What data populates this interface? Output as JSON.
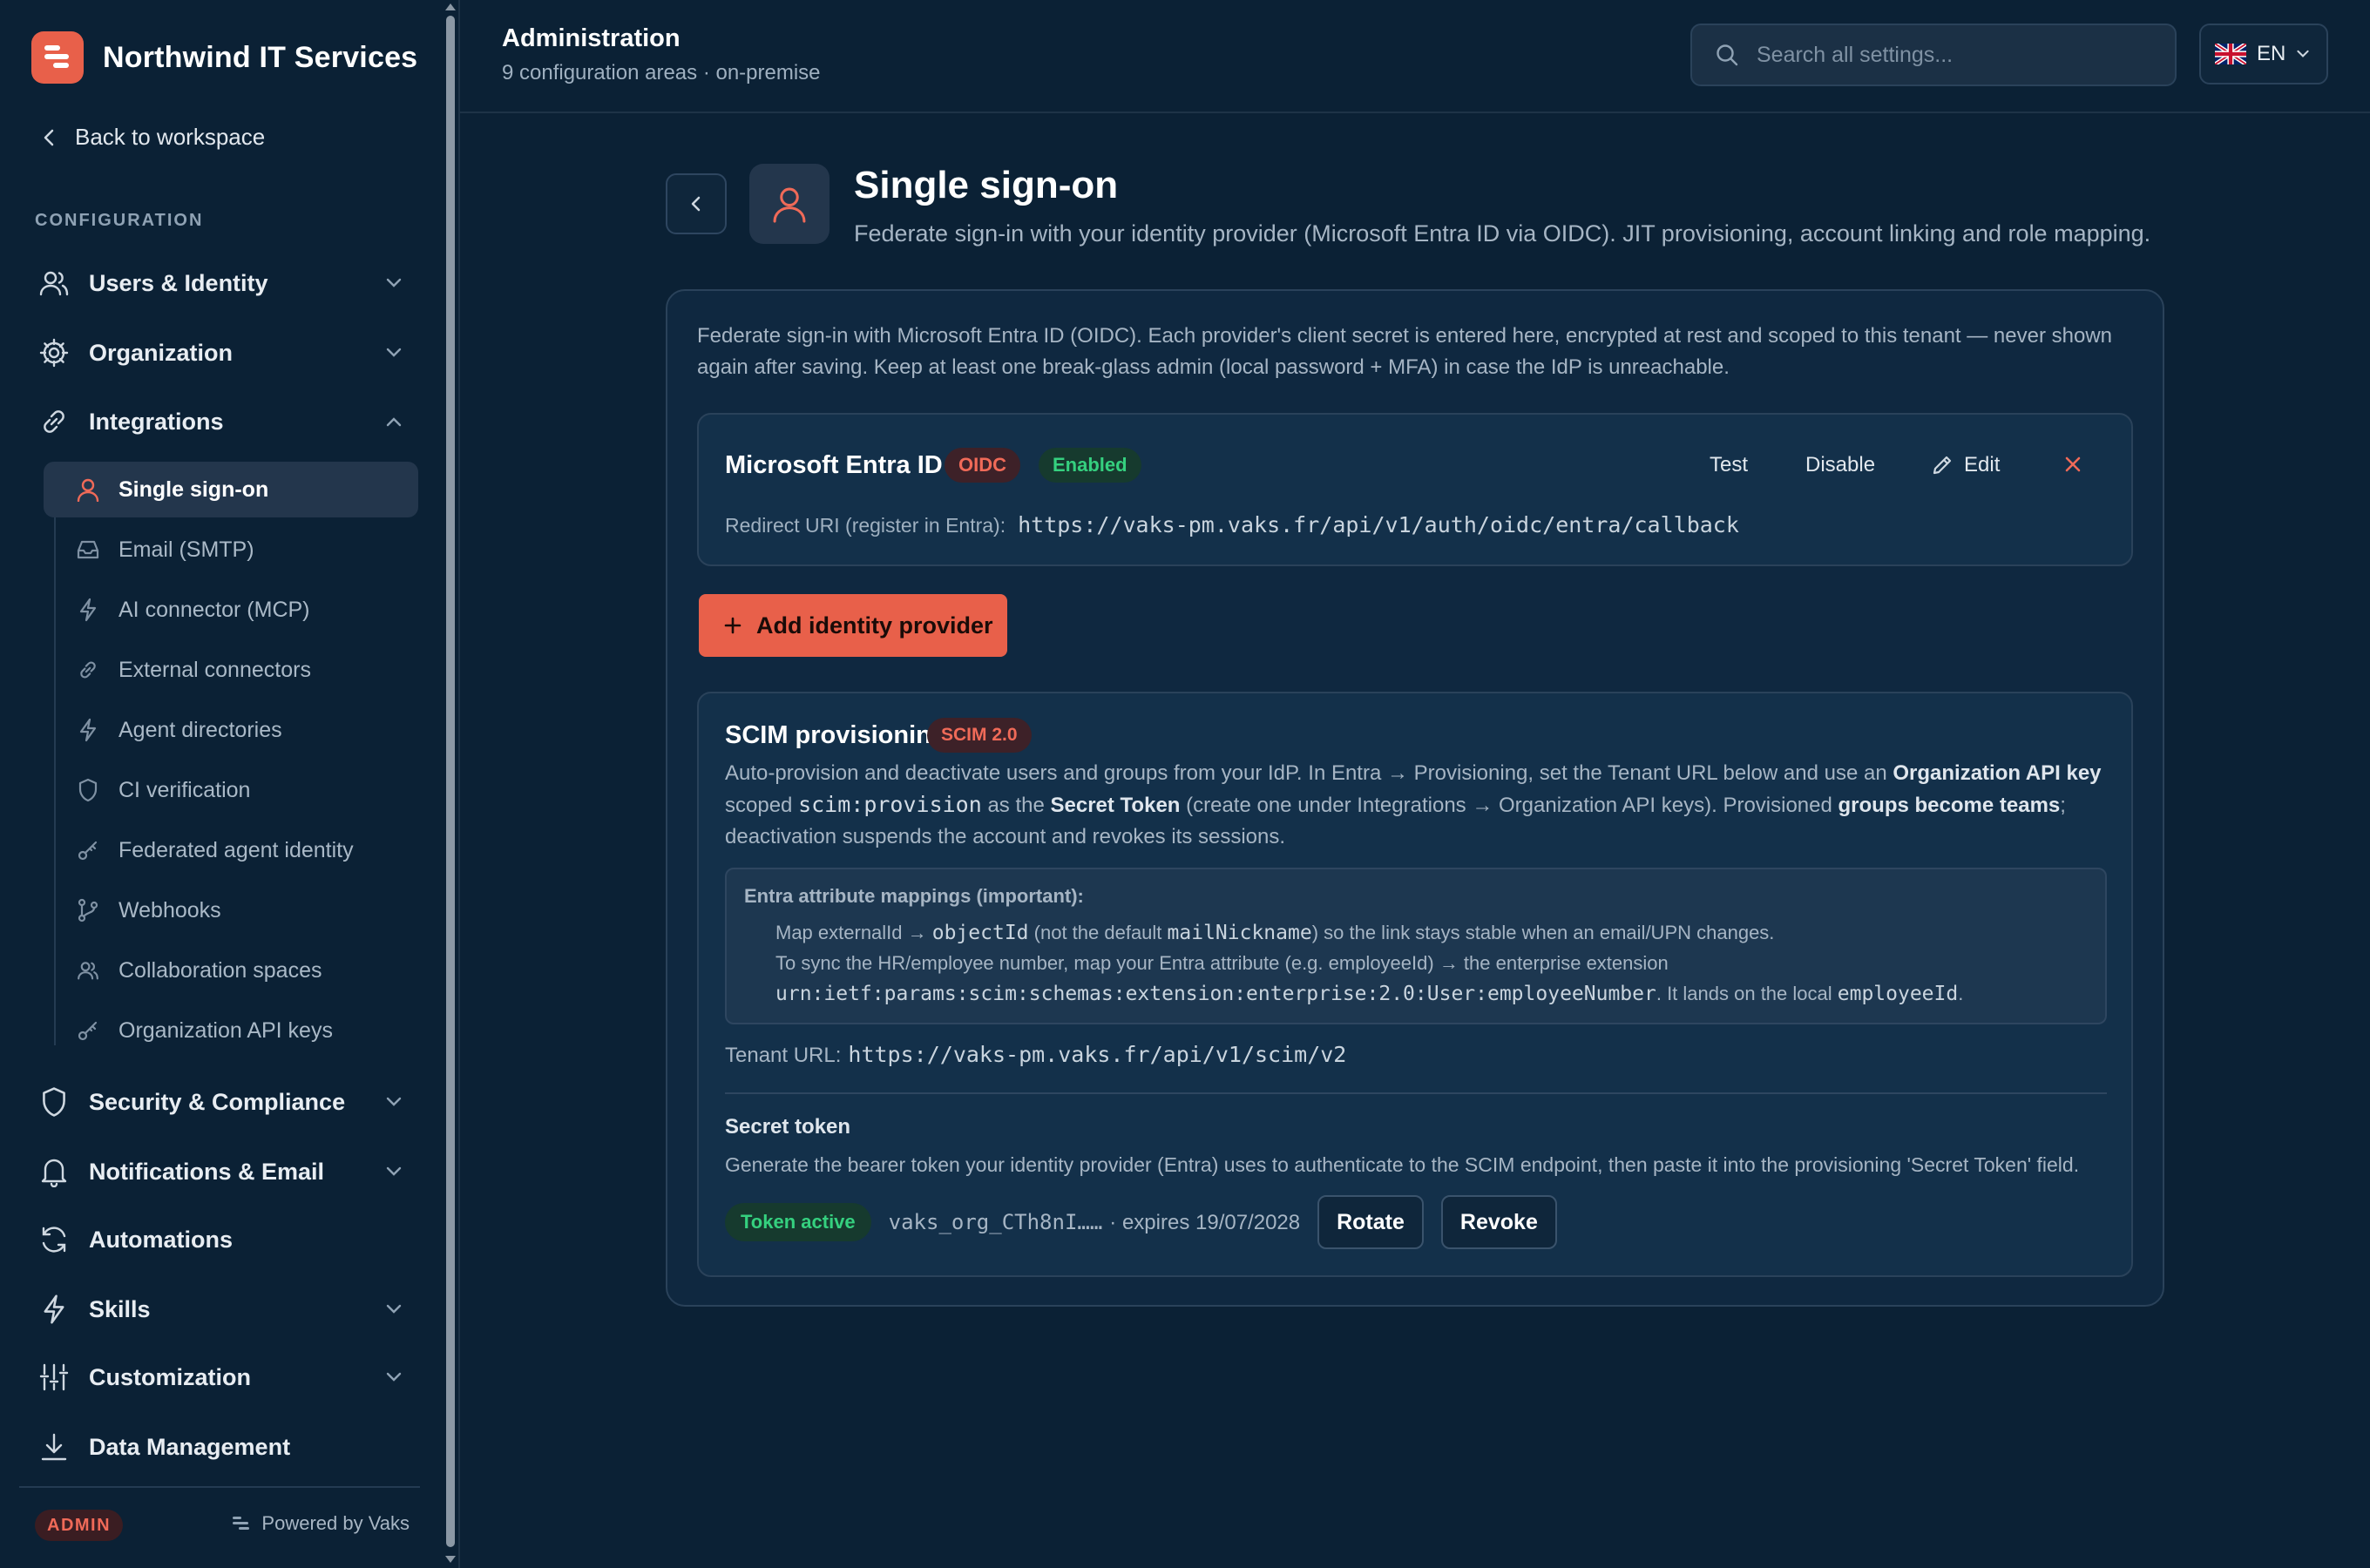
{
  "brand": {
    "name": "Northwind IT Services"
  },
  "sidebar": {
    "back_label": "Back to workspace",
    "section_label": "CONFIGURATION",
    "groups": [
      {
        "label": "Users & Identity",
        "icon": "users-icon",
        "state": "collapsed"
      },
      {
        "label": "Organization",
        "icon": "gear-icon",
        "state": "collapsed"
      },
      {
        "label": "Integrations",
        "icon": "link-icon",
        "state": "expanded"
      },
      {
        "label": "Security & Compliance",
        "icon": "shield-icon",
        "state": "collapsed"
      },
      {
        "label": "Notifications & Email",
        "icon": "bell-icon",
        "state": "collapsed"
      },
      {
        "label": "Automations",
        "icon": "refresh-icon",
        "state": "none"
      },
      {
        "label": "Skills",
        "icon": "bolt-icon",
        "state": "collapsed"
      },
      {
        "label": "Customization",
        "icon": "sliders-icon",
        "state": "collapsed"
      },
      {
        "label": "Data Management",
        "icon": "download-icon",
        "state": "none"
      }
    ],
    "integrations_items": [
      {
        "label": "Single sign-on",
        "icon": "user-icon",
        "active": true
      },
      {
        "label": "Email (SMTP)",
        "icon": "inbox-icon"
      },
      {
        "label": "AI connector (MCP)",
        "icon": "bolt-icon"
      },
      {
        "label": "External connectors",
        "icon": "link-icon"
      },
      {
        "label": "Agent directories",
        "icon": "bolt-icon"
      },
      {
        "label": "CI verification",
        "icon": "shield-icon"
      },
      {
        "label": "Federated agent identity",
        "icon": "key-icon"
      },
      {
        "label": "Webhooks",
        "icon": "git-branch-icon"
      },
      {
        "label": "Collaboration spaces",
        "icon": "users-icon"
      },
      {
        "label": "Organization API keys",
        "icon": "key-icon"
      }
    ],
    "role_badge": "ADMIN",
    "powered_by": "Powered by Vaks"
  },
  "header": {
    "title": "Administration",
    "subtitle": "9 configuration areas · on-premise",
    "search_placeholder": "Search all settings...",
    "language": "EN"
  },
  "page": {
    "title": "Single sign-on",
    "subtitle": "Federate sign-in with your identity provider (Microsoft Entra ID via OIDC). JIT provisioning, account linking and role mapping.",
    "intro": "Federate sign-in with Microsoft Entra ID (OIDC). Each provider's client secret is entered here, encrypted at rest and scoped to this tenant — never shown again after saving. Keep at least one break-glass admin (local password + MFA) in case the IdP is unreachable."
  },
  "provider": {
    "name": "Microsoft Entra ID",
    "protocol_badge": "OIDC",
    "status_badge": "Enabled",
    "actions": {
      "test": "Test",
      "disable": "Disable",
      "edit": "Edit"
    },
    "redirect_label": "Redirect URI (register in Entra):",
    "redirect_uri": "https://vaks-pm.vaks.fr/api/v1/auth/oidc/entra/callback"
  },
  "add_provider_label": "Add identity provider",
  "scim": {
    "title": "SCIM provisioning",
    "badge": "SCIM 2.0",
    "desc": {
      "p1": "Auto-provision and deactivate users and groups from your IdP. In Entra → Provisioning, set the Tenant URL below and use an ",
      "b1": "Organization API key",
      "p2": "scoped ",
      "code1": "scim:provision",
      "p3": " as the ",
      "b2": "Secret Token",
      "p4": " (create one under Integrations → Organization API keys). Provisioned ",
      "b3": "groups become teams",
      "p5": ";",
      "p6": "deactivation suspends the account and revokes its sessions."
    },
    "mappings": {
      "title": "Entra attribute mappings (important):",
      "l1a": "Map externalId → ",
      "l1code1": "objectId",
      "l1b": " (not the default ",
      "l1code2": "mailNickname",
      "l1c": ") so the link stays stable when an email/UPN changes.",
      "l2": "To sync the HR/employee number, map your Entra attribute (e.g. employeeId) → the enterprise extension",
      "l3code": "urn:ietf:params:scim:schemas:extension:enterprise:2.0:User:employeeNumber",
      "l3b": ". It lands on the local ",
      "l3code2": "employeeId",
      "l3c": "."
    },
    "tenant_label": "Tenant URL:",
    "tenant_url": "https://vaks-pm.vaks.fr/api/v1/scim/v2",
    "secret_title": "Secret token",
    "secret_desc": "Generate the bearer token your identity provider (Entra) uses to authenticate to the SCIM endpoint, then paste it into the provisioning 'Secret Token' field.",
    "token_badge": "Token active",
    "token_prefix": "vaks_org_CTh8nI……",
    "token_expiry": "· expires 19/07/2028",
    "rotate_label": "Rotate",
    "revoke_label": "Revoke"
  },
  "colors": {
    "accent": "#e8604a",
    "success": "#35d07f",
    "background": "#0b2135",
    "card": "#13304a"
  }
}
